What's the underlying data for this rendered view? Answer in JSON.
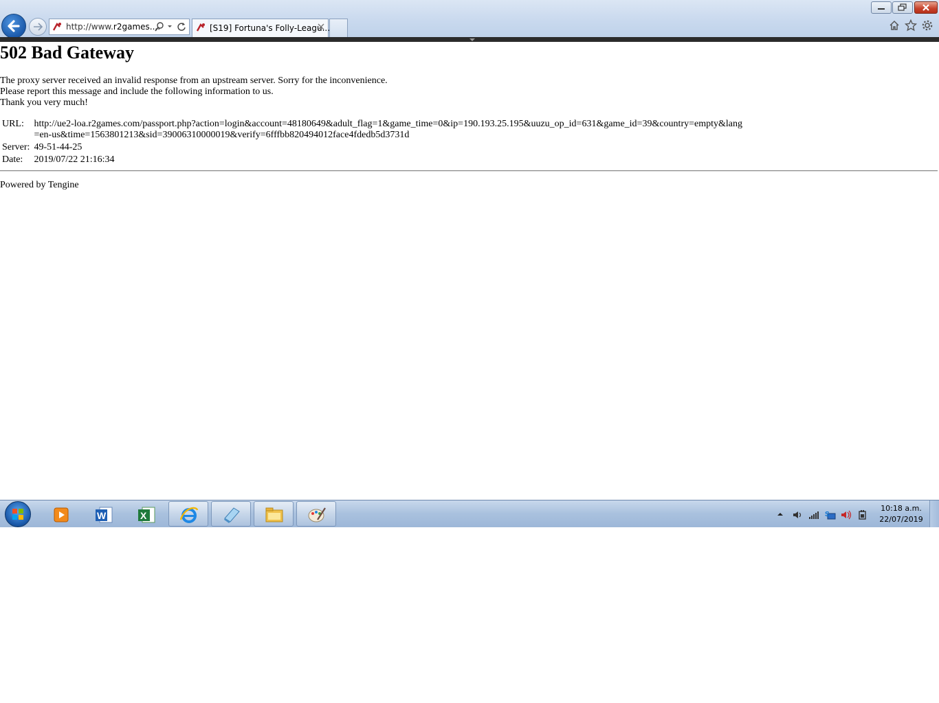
{
  "browser": {
    "address_url": "http://www.",
    "address_host": "r2games....",
    "active_tab_title": "[S19] Fortuna's Folly-Leagu...",
    "icons": {
      "back": "back-arrow-icon",
      "forward": "forward-arrow-icon",
      "search": "search-icon",
      "dropdown": "chevron-down-icon",
      "refresh": "refresh-icon",
      "close_tab": "close-icon",
      "home": "home-icon",
      "favorites": "star-icon",
      "tools": "gear-icon"
    }
  },
  "page": {
    "heading": "502 Bad Gateway",
    "message_lines": [
      "The proxy server received an invalid response from an upstream server. Sorry for the inconvenience.",
      "Please report this message and include the following information to us.",
      "Thank you very much!"
    ],
    "info": [
      {
        "key": "URL:",
        "value": "http://ue2-loa.r2games.com/passport.php?action=login&account=48180649&adult_flag=1&game_time=0&ip=190.193.25.195&uuzu_op_id=631&game_id=39&country=empty&lang=en-us&time=1563801213&sid=39006310000019&verify=6fffbb820494012face4fdedb5d3731d"
      },
      {
        "key": "Server:",
        "value": "49-51-44-25"
      },
      {
        "key": "Date:",
        "value": "2019/07/22 21:16:34"
      }
    ],
    "footer": "Powered by Tengine"
  },
  "taskbar": {
    "apps": [
      {
        "name": "media-player",
        "state": "pinned"
      },
      {
        "name": "word",
        "state": "pinned"
      },
      {
        "name": "excel",
        "state": "pinned"
      },
      {
        "name": "internet-explorer",
        "state": "open"
      },
      {
        "name": "notepad",
        "state": "open"
      },
      {
        "name": "file-explorer",
        "state": "open"
      },
      {
        "name": "paint",
        "state": "open"
      }
    ],
    "clock_time": "10:18 a.m.",
    "clock_date": "22/07/2019"
  },
  "colors": {
    "chrome_bg": "#c9d9ee",
    "taskbar_bg": "#a9c1de",
    "close_button": "#c6412a",
    "text": "#000000"
  }
}
